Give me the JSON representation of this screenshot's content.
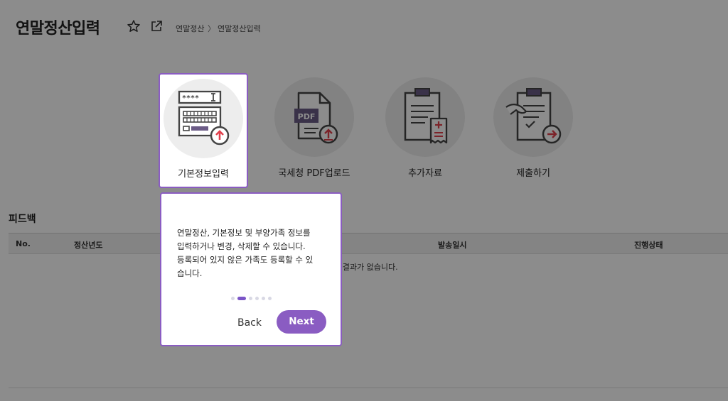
{
  "header": {
    "title": "연말정산입력",
    "breadcrumb": [
      "연말정산",
      "연말정산입력"
    ],
    "breadcrumb_sep": "〉"
  },
  "steps": [
    {
      "label": "기본정보입력",
      "icon": "keyboard-form-icon"
    },
    {
      "label": "국세청 PDF업로드",
      "icon": "pdf-upload-icon"
    },
    {
      "label": "추가자료",
      "icon": "clipboard-receipt-icon"
    },
    {
      "label": "제출하기",
      "icon": "clipboard-submit-icon"
    }
  ],
  "feedback": {
    "title": "피드백",
    "columns": [
      "No.",
      "정산년도",
      "발송일시",
      "진행상태"
    ],
    "empty_message": "검색 결과가 없습니다."
  },
  "tooltip": {
    "lines": [
      "연말정산, 기본정보 및 부양가족 정보를",
      "입력하거나 변경, 삭제할 수 있습니다.",
      "등록되어 있지 않은 가족도 등록할 수 있",
      "습니다."
    ],
    "total_steps": 6,
    "active_step": 2,
    "back_label": "Back",
    "next_label": "Next"
  },
  "colors": {
    "accent": "#8a5cc2",
    "icon_red": "#e2404c",
    "icon_stroke": "#444444",
    "pdf_purple": "#6b5b86"
  }
}
